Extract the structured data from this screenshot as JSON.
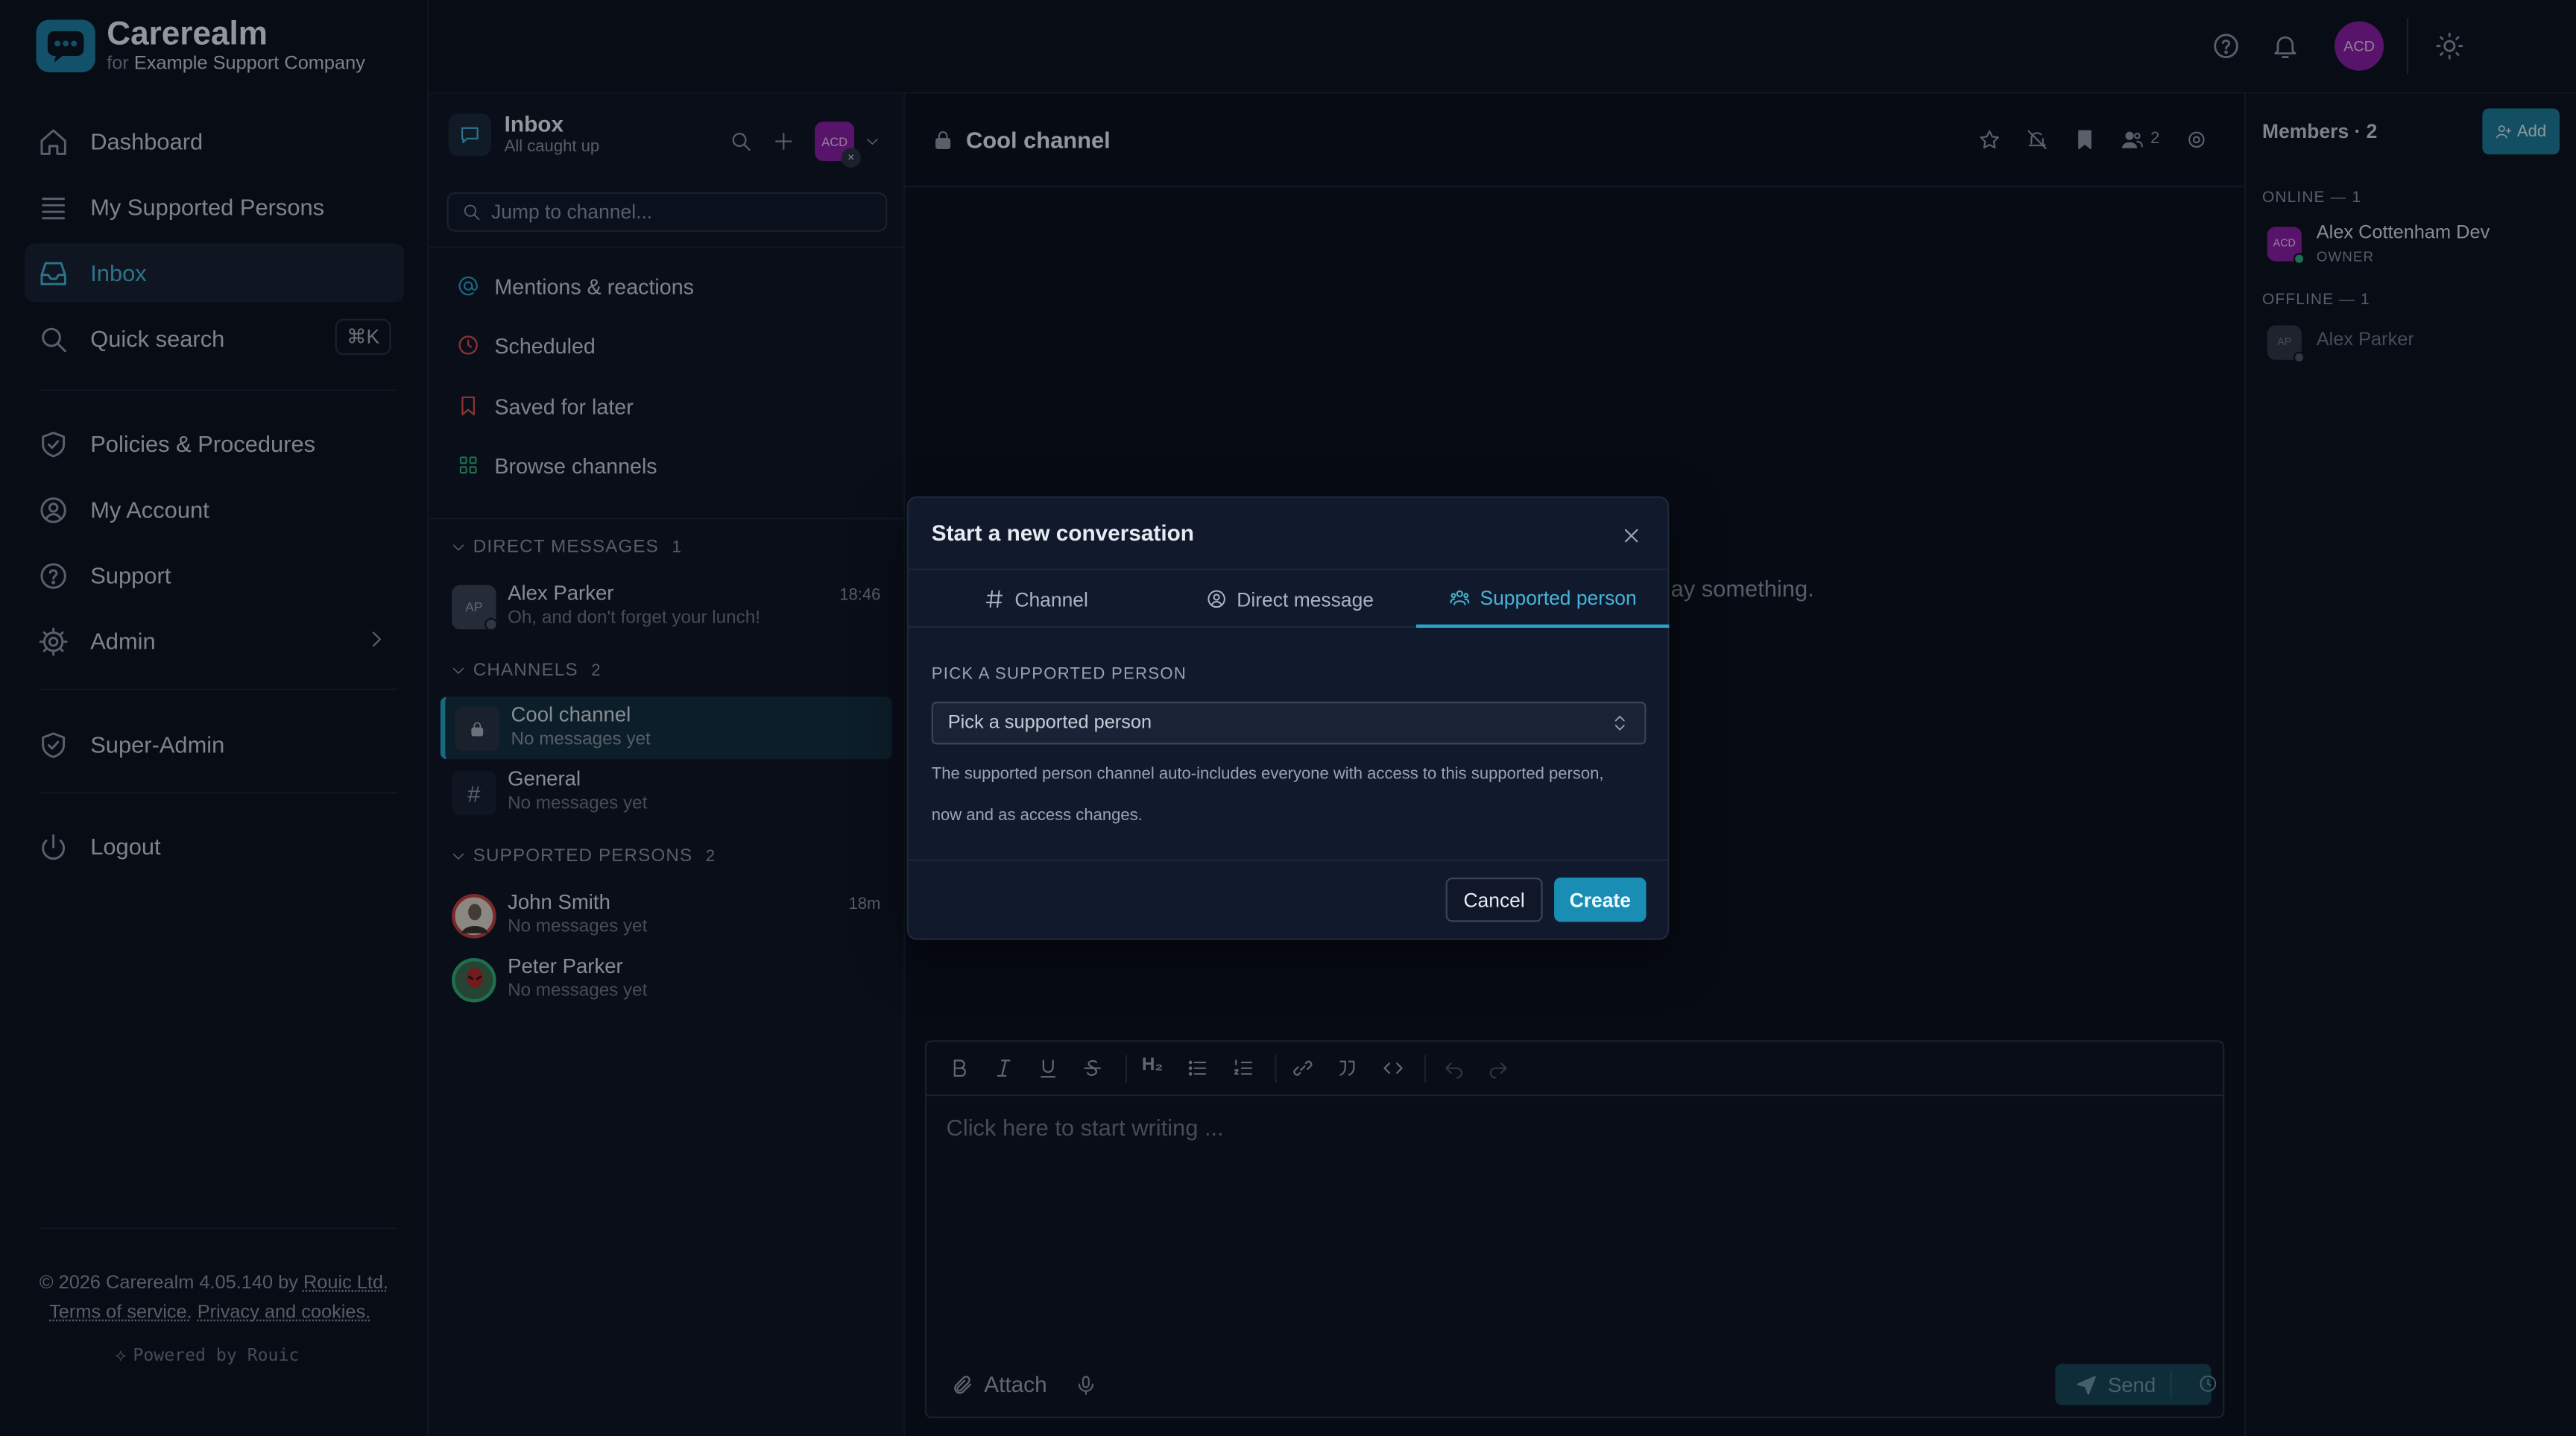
{
  "brand": {
    "name": "Carerealm",
    "for_prefix": "for",
    "org": "Example Support Company",
    "accent": "#1e7fa6"
  },
  "nav": {
    "items": [
      {
        "label": "Dashboard",
        "icon": "home-icon"
      },
      {
        "label": "My Supported Persons",
        "icon": "list-icon"
      },
      {
        "label": "Inbox",
        "icon": "inbox-icon",
        "active": true
      },
      {
        "label": "Quick search",
        "icon": "search-icon",
        "shortcut": "⌘K"
      },
      {
        "label": "Policies & Procedures",
        "icon": "shield-check-icon"
      },
      {
        "label": "My Account",
        "icon": "user-circle-icon"
      },
      {
        "label": "Support",
        "icon": "help-circle-icon"
      },
      {
        "label": "Admin",
        "icon": "gear-icon"
      },
      {
        "label": "Super-Admin",
        "icon": "shield-check-icon"
      },
      {
        "label": "Logout",
        "icon": "power-icon"
      }
    ],
    "footer": {
      "copyright": "© 2026 Carerealm 4.05.140 by",
      "company_link": "Rouic Ltd.",
      "terms": "Terms of service.",
      "privacy": "Privacy and cookies.",
      "powered": "Powered by Rouic"
    }
  },
  "topbar": {
    "avatar": "ACD",
    "avatar_color": "#8a1fa8"
  },
  "chlist": {
    "title": "Inbox",
    "subtitle": "All caught up",
    "avatar": "ACD",
    "search_placeholder": "Jump to channel...",
    "quick_links": [
      {
        "label": "Mentions & reactions",
        "icon": "at-sign-icon",
        "color": "#2aa3c8"
      },
      {
        "label": "Scheduled",
        "icon": "clock-icon",
        "color": "#e05252"
      },
      {
        "label": "Saved for later",
        "icon": "bookmark-icon",
        "color": "#e05252"
      },
      {
        "label": "Browse channels",
        "icon": "grid-icon",
        "color": "#2fae7a"
      }
    ],
    "dm_section": {
      "label": "DIRECT MESSAGES",
      "count": "1"
    },
    "dms": [
      {
        "initials": "AP",
        "name": "Alex Parker",
        "preview": "Oh, and don't forget your lunch!",
        "time": "18:46"
      }
    ],
    "channel_section": {
      "label": "CHANNELS",
      "count": "2"
    },
    "channels": [
      {
        "name": "Cool channel",
        "preview": "No messages yet",
        "icon": "lock-icon",
        "active": true
      },
      {
        "name": "General",
        "preview": "No messages yet",
        "icon": "hash-icon"
      }
    ],
    "sp_section": {
      "label": "SUPPORTED PERSONS",
      "count": "2"
    },
    "supported": [
      {
        "name": "John Smith",
        "preview": "No messages yet",
        "time": "18m"
      },
      {
        "name": "Peter Parker",
        "preview": "No messages yet"
      }
    ]
  },
  "main": {
    "channel_title": "Cool channel",
    "members_count": "2",
    "empty_text": "ay something.",
    "editor_placeholder": "Click here to start writing ...",
    "attach_label": "Attach",
    "send_label": "Send"
  },
  "members": {
    "title": "Members · 2",
    "add_label": "Add",
    "online_label": "ONLINE — 1",
    "offline_label": "OFFLINE — 1",
    "online": [
      {
        "initials": "ACD",
        "name": "Alex Cottenham Dev",
        "role": "OWNER"
      }
    ],
    "offline": [
      {
        "initials": "AP",
        "name": "Alex Parker"
      }
    ]
  },
  "modal": {
    "title": "Start a new conversation",
    "tabs": [
      {
        "label": "Channel",
        "icon": "hash-icon"
      },
      {
        "label": "Direct message",
        "icon": "user-circle-icon"
      },
      {
        "label": "Supported person",
        "icon": "users-icon",
        "active": true
      }
    ],
    "pick_label": "PICK A SUPPORTED PERSON",
    "select_value": "Pick a supported person",
    "help": "The supported person channel auto-includes everyone with access to this supported person, now and as access changes.",
    "cancel": "Cancel",
    "create": "Create"
  }
}
